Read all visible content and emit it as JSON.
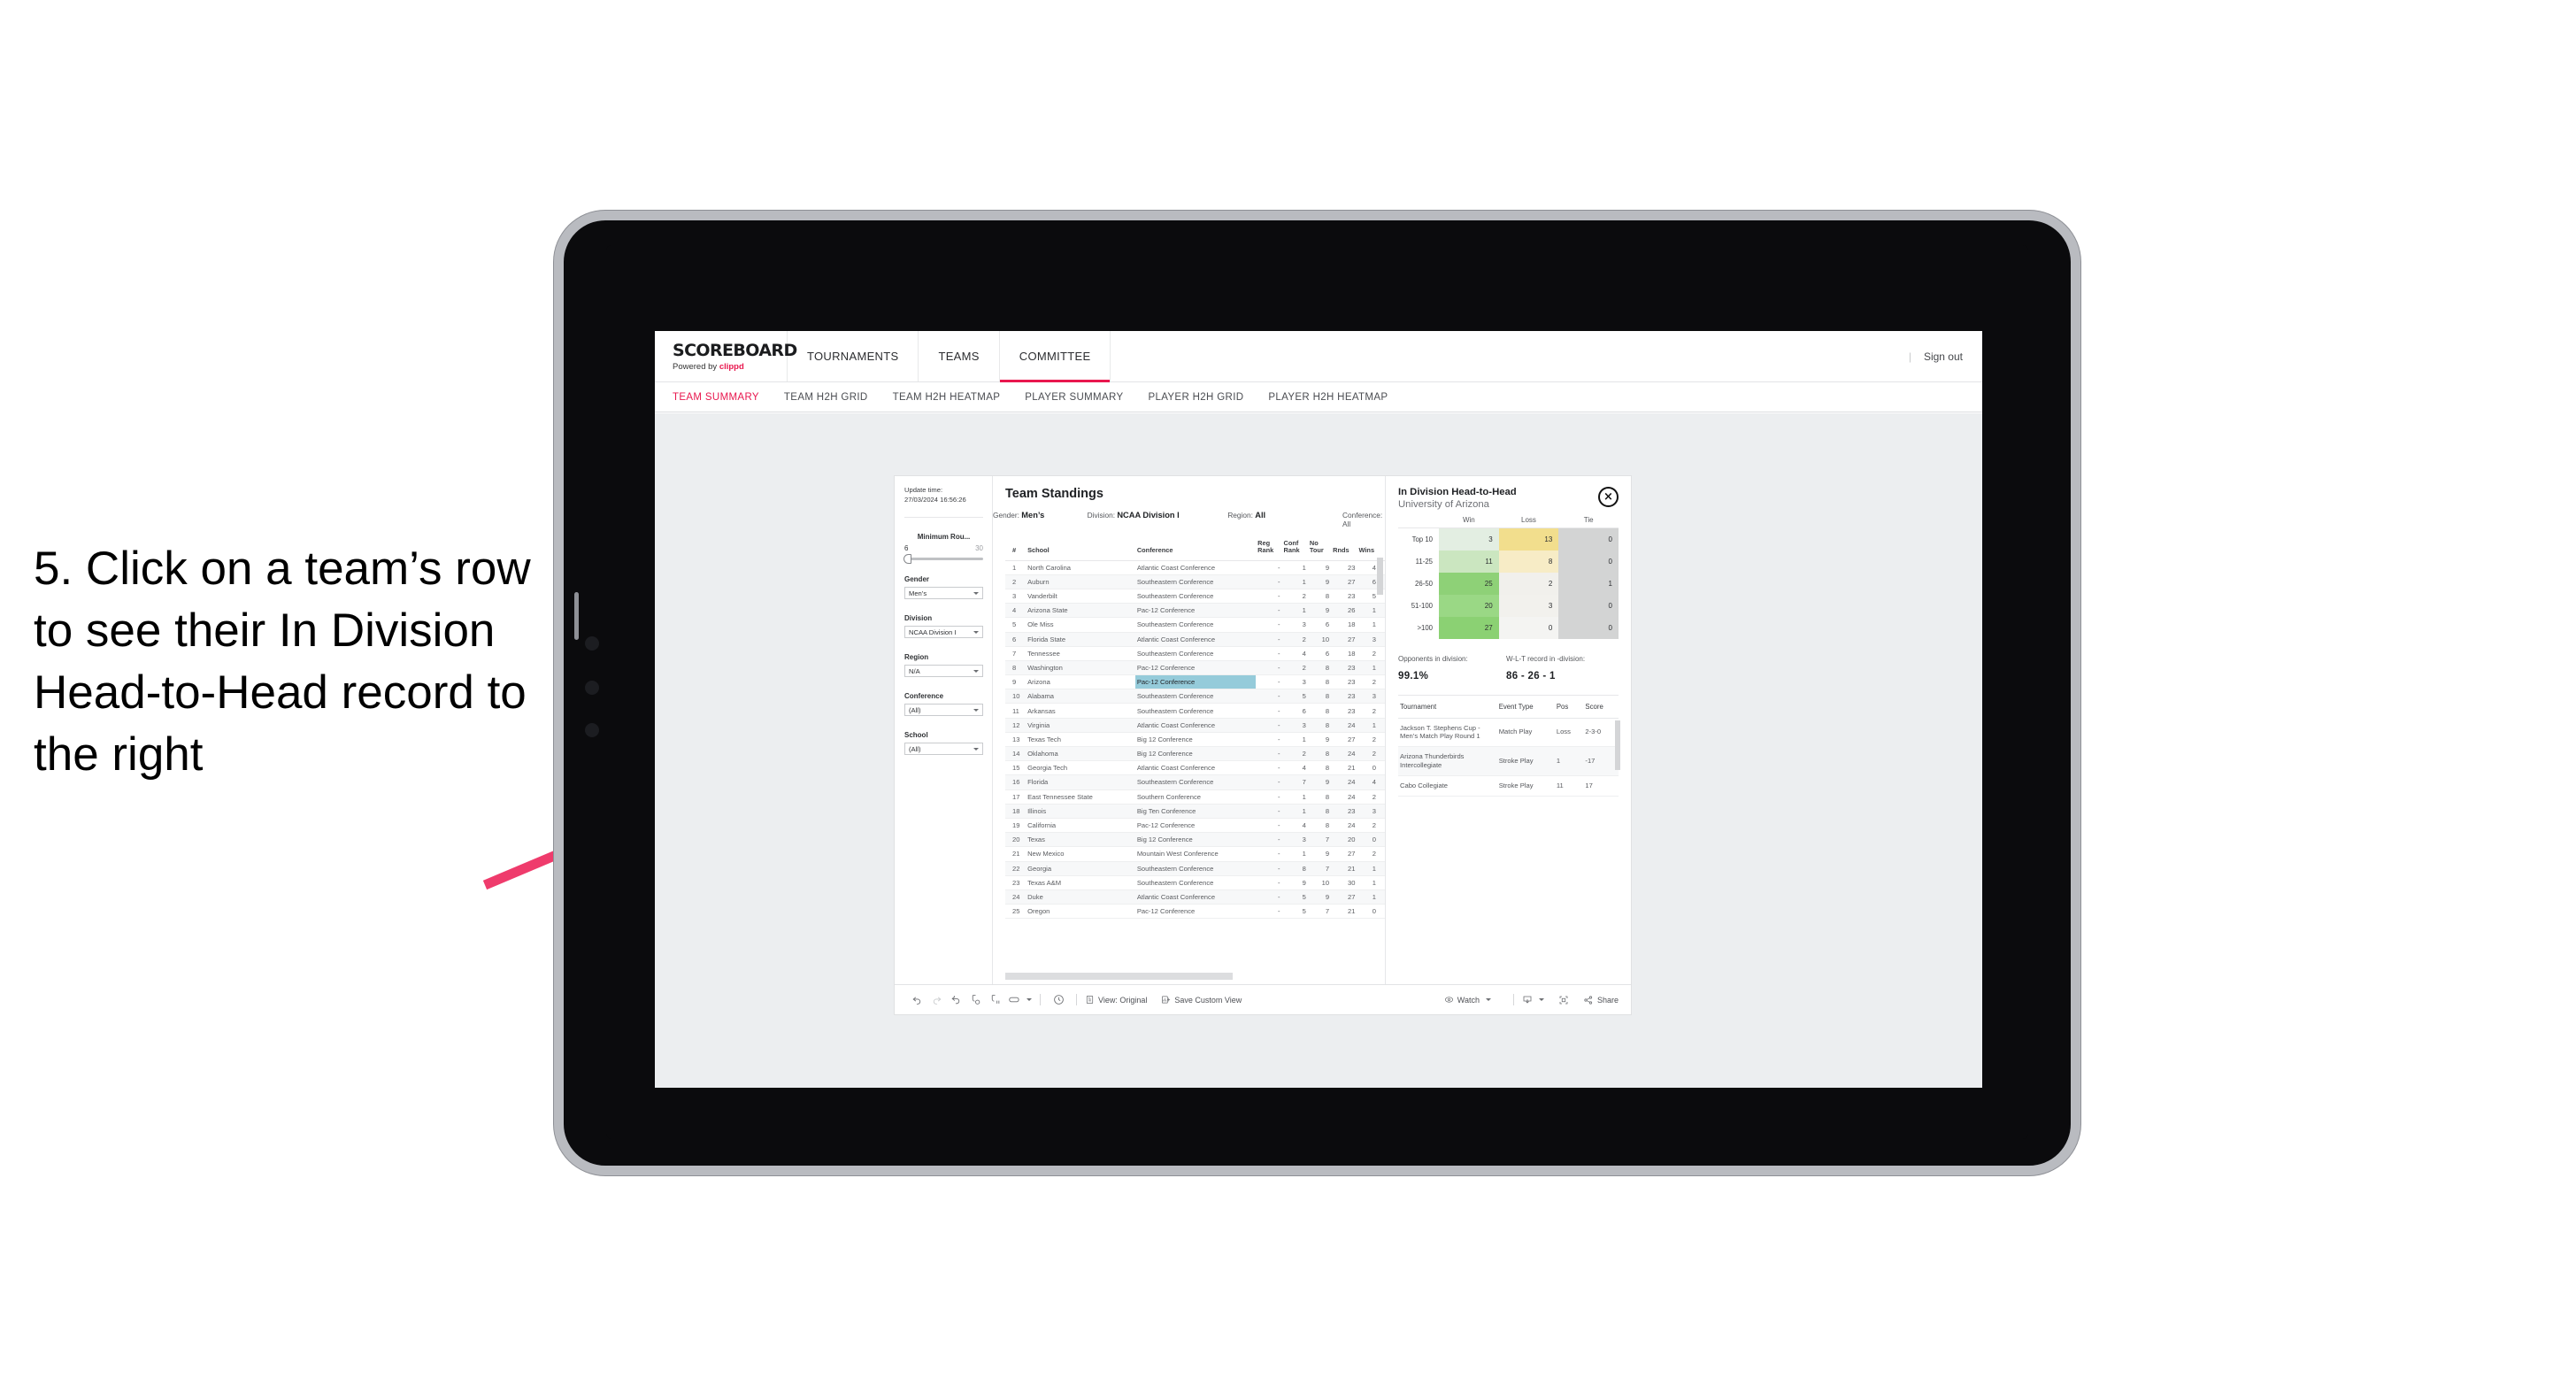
{
  "annotation": {
    "text": "5. Click on a team’s row to see their In Division Head-to-Head record to the right",
    "arrow_color": "#ef3b6c"
  },
  "topnav": {
    "brand_title": "SCOREBOARD",
    "brand_sub_prefix": "Powered by ",
    "brand_sub_accent": "clippd",
    "items": [
      {
        "label": "TOURNAMENTS",
        "active": false
      },
      {
        "label": "TEAMS",
        "active": false
      },
      {
        "label": "COMMITTEE",
        "active": true
      }
    ],
    "separator": "|",
    "sign_out": "Sign out",
    "accent": "#e8174e"
  },
  "subnav": {
    "items": [
      {
        "label": "TEAM SUMMARY",
        "active": true
      },
      {
        "label": "TEAM H2H GRID",
        "active": false
      },
      {
        "label": "TEAM H2H HEATMAP",
        "active": false
      },
      {
        "label": "PLAYER SUMMARY",
        "active": false
      },
      {
        "label": "PLAYER H2H GRID",
        "active": false
      },
      {
        "label": "PLAYER H2H HEATMAP",
        "active": false
      }
    ]
  },
  "filters": {
    "update_time_label": "Update time:",
    "update_time_value": "27/03/2024 16:56:26",
    "slider": {
      "label": "Minimum Rou...",
      "min": "6",
      "max": "30"
    },
    "groups": [
      {
        "label": "Gender",
        "value": "Men’s"
      },
      {
        "label": "Division",
        "value": "NCAA Division I"
      },
      {
        "label": "Region",
        "value": "N/A"
      },
      {
        "label": "Conference",
        "value": "(All)"
      },
      {
        "label": "School",
        "value": "(All)"
      }
    ]
  },
  "standings": {
    "title": "Team Standings",
    "meta": [
      {
        "label": "Gender:",
        "value": "Men’s"
      },
      {
        "label": "Division:",
        "value": "NCAA Division I"
      },
      {
        "label": "Region:",
        "value": "All"
      },
      {
        "label": "Conference:",
        "value": "All"
      }
    ],
    "columns": [
      "#",
      "School",
      "Conference",
      "Reg Rank",
      "Conf Rank",
      "No Tour",
      "Rnds",
      "Wins"
    ],
    "rows": [
      {
        "n": "1",
        "school": "North Carolina",
        "conf": "Atlantic Coast Conference",
        "reg": "-",
        "confrank": "1",
        "notour": "9",
        "rnds": "23",
        "wins": "4",
        "selected": false
      },
      {
        "n": "2",
        "school": "Auburn",
        "conf": "Southeastern Conference",
        "reg": "-",
        "confrank": "1",
        "notour": "9",
        "rnds": "27",
        "wins": "6",
        "selected": false
      },
      {
        "n": "3",
        "school": "Vanderbilt",
        "conf": "Southeastern Conference",
        "reg": "-",
        "confrank": "2",
        "notour": "8",
        "rnds": "23",
        "wins": "5",
        "selected": false
      },
      {
        "n": "4",
        "school": "Arizona State",
        "conf": "Pac-12 Conference",
        "reg": "-",
        "confrank": "1",
        "notour": "9",
        "rnds": "26",
        "wins": "1",
        "selected": false
      },
      {
        "n": "5",
        "school": "Ole Miss",
        "conf": "Southeastern Conference",
        "reg": "-",
        "confrank": "3",
        "notour": "6",
        "rnds": "18",
        "wins": "1",
        "selected": false
      },
      {
        "n": "6",
        "school": "Florida State",
        "conf": "Atlantic Coast Conference",
        "reg": "-",
        "confrank": "2",
        "notour": "10",
        "rnds": "27",
        "wins": "3",
        "selected": false
      },
      {
        "n": "7",
        "school": "Tennessee",
        "conf": "Southeastern Conference",
        "reg": "-",
        "confrank": "4",
        "notour": "6",
        "rnds": "18",
        "wins": "2",
        "selected": false
      },
      {
        "n": "8",
        "school": "Washington",
        "conf": "Pac-12 Conference",
        "reg": "-",
        "confrank": "2",
        "notour": "8",
        "rnds": "23",
        "wins": "1",
        "selected": false
      },
      {
        "n": "9",
        "school": "Arizona",
        "conf": "Pac-12 Conference",
        "reg": "-",
        "confrank": "3",
        "notour": "8",
        "rnds": "23",
        "wins": "2",
        "selected": true
      },
      {
        "n": "10",
        "school": "Alabama",
        "conf": "Southeastern Conference",
        "reg": "-",
        "confrank": "5",
        "notour": "8",
        "rnds": "23",
        "wins": "3",
        "selected": false
      },
      {
        "n": "11",
        "school": "Arkansas",
        "conf": "Southeastern Conference",
        "reg": "-",
        "confrank": "6",
        "notour": "8",
        "rnds": "23",
        "wins": "2",
        "selected": false
      },
      {
        "n": "12",
        "school": "Virginia",
        "conf": "Atlantic Coast Conference",
        "reg": "-",
        "confrank": "3",
        "notour": "8",
        "rnds": "24",
        "wins": "1",
        "selected": false
      },
      {
        "n": "13",
        "school": "Texas Tech",
        "conf": "Big 12 Conference",
        "reg": "-",
        "confrank": "1",
        "notour": "9",
        "rnds": "27",
        "wins": "2",
        "selected": false
      },
      {
        "n": "14",
        "school": "Oklahoma",
        "conf": "Big 12 Conference",
        "reg": "-",
        "confrank": "2",
        "notour": "8",
        "rnds": "24",
        "wins": "2",
        "selected": false
      },
      {
        "n": "15",
        "school": "Georgia Tech",
        "conf": "Atlantic Coast Conference",
        "reg": "-",
        "confrank": "4",
        "notour": "8",
        "rnds": "21",
        "wins": "0",
        "selected": false
      },
      {
        "n": "16",
        "school": "Florida",
        "conf": "Southeastern Conference",
        "reg": "-",
        "confrank": "7",
        "notour": "9",
        "rnds": "24",
        "wins": "4",
        "selected": false
      },
      {
        "n": "17",
        "school": "East Tennessee State",
        "conf": "Southern Conference",
        "reg": "-",
        "confrank": "1",
        "notour": "8",
        "rnds": "24",
        "wins": "2",
        "selected": false
      },
      {
        "n": "18",
        "school": "Illinois",
        "conf": "Big Ten Conference",
        "reg": "-",
        "confrank": "1",
        "notour": "8",
        "rnds": "23",
        "wins": "3",
        "selected": false
      },
      {
        "n": "19",
        "school": "California",
        "conf": "Pac-12 Conference",
        "reg": "-",
        "confrank": "4",
        "notour": "8",
        "rnds": "24",
        "wins": "2",
        "selected": false
      },
      {
        "n": "20",
        "school": "Texas",
        "conf": "Big 12 Conference",
        "reg": "-",
        "confrank": "3",
        "notour": "7",
        "rnds": "20",
        "wins": "0",
        "selected": false
      },
      {
        "n": "21",
        "school": "New Mexico",
        "conf": "Mountain West Conference",
        "reg": "-",
        "confrank": "1",
        "notour": "9",
        "rnds": "27",
        "wins": "2",
        "selected": false
      },
      {
        "n": "22",
        "school": "Georgia",
        "conf": "Southeastern Conference",
        "reg": "-",
        "confrank": "8",
        "notour": "7",
        "rnds": "21",
        "wins": "1",
        "selected": false
      },
      {
        "n": "23",
        "school": "Texas A&M",
        "conf": "Southeastern Conference",
        "reg": "-",
        "confrank": "9",
        "notour": "10",
        "rnds": "30",
        "wins": "1",
        "selected": false
      },
      {
        "n": "24",
        "school": "Duke",
        "conf": "Atlantic Coast Conference",
        "reg": "-",
        "confrank": "5",
        "notour": "9",
        "rnds": "27",
        "wins": "1",
        "selected": false
      },
      {
        "n": "25",
        "school": "Oregon",
        "conf": "Pac-12 Conference",
        "reg": "-",
        "confrank": "5",
        "notour": "7",
        "rnds": "21",
        "wins": "0",
        "selected": false
      }
    ]
  },
  "detail": {
    "title": "In Division Head-to-Head",
    "subtitle": "University of Arizona",
    "close_label": "×",
    "chart_data": {
      "type": "heatmap",
      "title": "In Division Head-to-Head",
      "xlabel": "",
      "ylabel": "",
      "columns": [
        "Win",
        "Loss",
        "Tie"
      ],
      "categories": [
        "Top 10",
        "11-25",
        "26-50",
        "51-100",
        ">100"
      ],
      "values": [
        [
          3,
          13,
          0
        ],
        [
          11,
          8,
          0
        ],
        [
          25,
          2,
          1
        ],
        [
          20,
          3,
          0
        ],
        [
          27,
          0,
          0
        ]
      ],
      "cell_colors": [
        [
          "#e3eee2",
          "#f2de8d",
          "#d3d4d4"
        ],
        [
          "#cbe6c0",
          "#f7ecc6",
          "#d3d4d4"
        ],
        [
          "#8ed177",
          "#f1f0ec",
          "#d3d4d4"
        ],
        [
          "#9ad885",
          "#f2f1ed",
          "#d3d4d4"
        ],
        [
          "#8bd173",
          "#f4f4f2",
          "#d3d4d4"
        ]
      ]
    },
    "kpis": [
      {
        "label": "Opponents in division:",
        "value": "99.1%"
      },
      {
        "label": "W-L-T record in -division:",
        "value": "86 - 26 - 1"
      }
    ],
    "events": {
      "columns": [
        "Tournament",
        "Event Type",
        "Pos",
        "Score"
      ],
      "rows": [
        {
          "tournament": "Jackson T. Stephens Cup - Men’s Match Play Round 1",
          "type": "Match Play",
          "pos": "Loss",
          "score": "2-3-0"
        },
        {
          "tournament": "Arizona Thunderbirds Intercollegiate",
          "type": "Stroke Play",
          "pos": "1",
          "score": "-17"
        },
        {
          "tournament": "Cabo Collegiate",
          "type": "Stroke Play",
          "pos": "11",
          "score": "17"
        }
      ]
    }
  },
  "toolbar": {
    "icons": [
      "undo-icon",
      "redo-icon",
      "revert-icon",
      "refresh-data-icon",
      "pause-updates-icon",
      "device-layout-icon"
    ],
    "clock_icon": "clock-icon",
    "view_label": "View: Original",
    "save_label": "Save Custom View",
    "watch_label": "Watch",
    "download_icon": "download-icon",
    "fullscreen_icon": "fullscreen-icon",
    "share_label": "Share"
  }
}
